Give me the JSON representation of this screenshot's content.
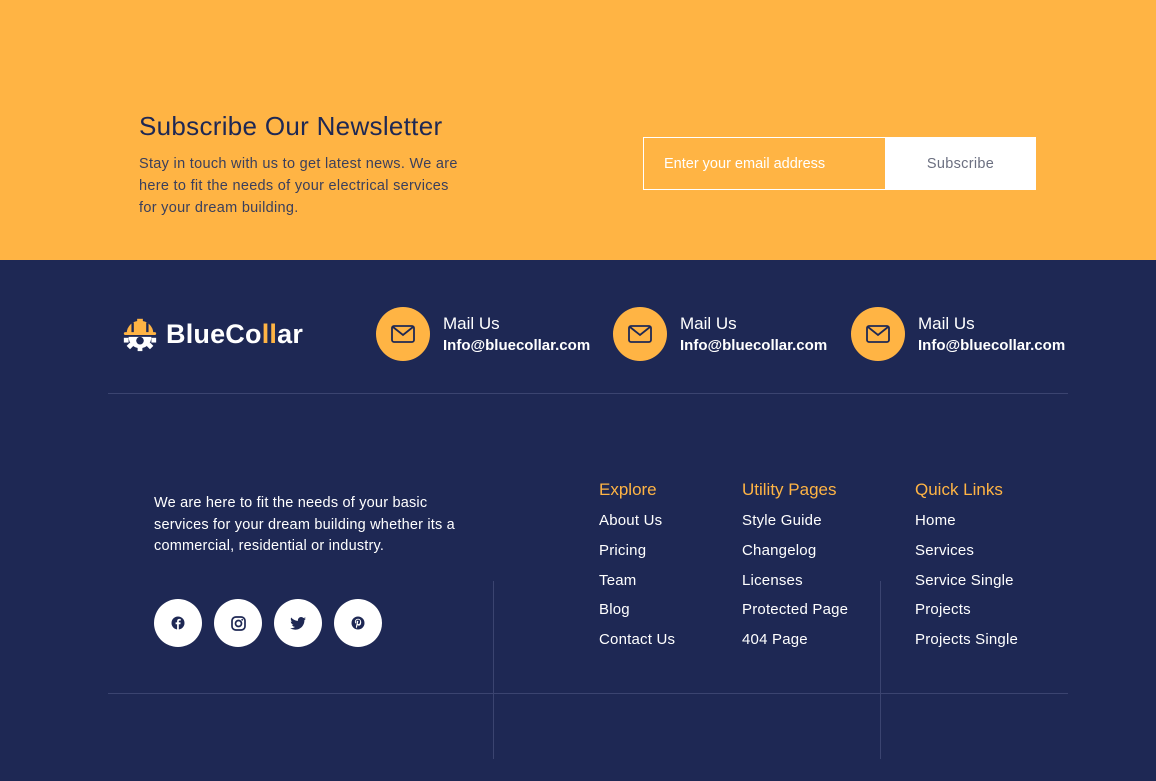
{
  "newsletter": {
    "title": "Subscribe Our Newsletter",
    "text": "Stay in touch with us to get latest news. We are here to fit the needs of your electrical services for your dream building.",
    "input_placeholder": "Enter your email address",
    "button_label": "Subscribe"
  },
  "brand": {
    "name_part1": "BlueCo",
    "name_accent": "ll",
    "name_part2": "ar"
  },
  "contacts": [
    {
      "label": "Mail Us",
      "value": "Info@bluecollar.com",
      "icon": "mail-icon"
    },
    {
      "label": "Mail Us",
      "value": "Info@bluecollar.com",
      "icon": "mail-icon"
    },
    {
      "label": "Mail Us",
      "value": "Info@bluecollar.com",
      "icon": "mail-icon"
    }
  ],
  "about": {
    "text": "We are here to fit the needs of your basic services for your dream building whether its a commercial, residential or industry."
  },
  "social": [
    "facebook-icon",
    "instagram-icon",
    "twitter-icon",
    "pinterest-icon"
  ],
  "columns": {
    "explore": {
      "title": "Explore",
      "links": [
        "About Us",
        "Pricing",
        "Team",
        "Blog",
        "Contact Us"
      ]
    },
    "utility": {
      "title": "Utility Pages",
      "links": [
        "Style Guide",
        "Changelog",
        "Licenses",
        "Protected Page",
        "404 Page"
      ]
    },
    "quick": {
      "title": "Quick Links",
      "links": [
        "Home",
        "Services",
        "Service Single",
        "Projects",
        "Projects Single"
      ]
    }
  },
  "colors": {
    "accent": "#ffb444",
    "navy": "#1e2854",
    "white": "#ffffff"
  }
}
